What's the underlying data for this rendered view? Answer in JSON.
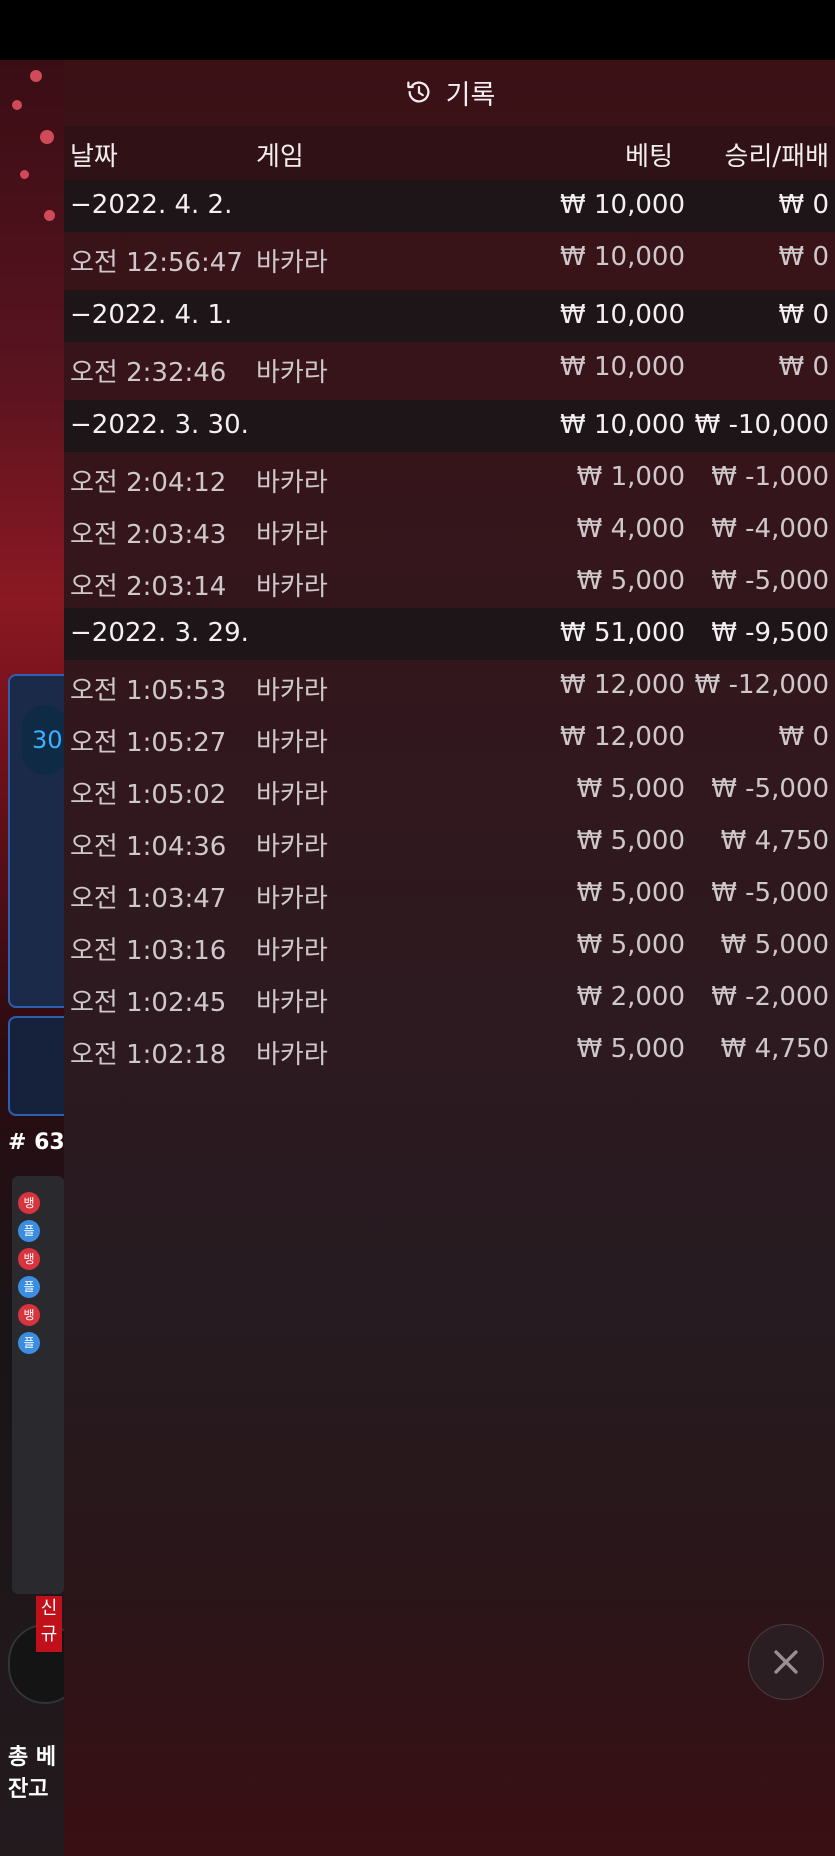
{
  "title": "기록",
  "headers": {
    "date": "날짜",
    "game": "게임",
    "bet": "베팅",
    "result": "승리/패배"
  },
  "groups": [
    {
      "date": "−2022. 4. 2.",
      "bet": "₩ 10,000",
      "result": "₩ 0",
      "rows": [
        {
          "time": "오전 12:56:47",
          "game": "바카라",
          "bet": "₩ 10,000",
          "result": "₩ 0"
        }
      ]
    },
    {
      "date": "−2022. 4. 1.",
      "bet": "₩ 10,000",
      "result": "₩ 0",
      "rows": [
        {
          "time": "오전 2:32:46",
          "game": "바카라",
          "bet": "₩ 10,000",
          "result": "₩ 0"
        }
      ]
    },
    {
      "date": "−2022. 3. 30.",
      "bet": "₩ 10,000",
      "result": "₩ -10,000",
      "rows": [
        {
          "time": "오전 2:04:12",
          "game": "바카라",
          "bet": "₩ 1,000",
          "result": "₩ -1,000"
        },
        {
          "time": "오전 2:03:43",
          "game": "바카라",
          "bet": "₩ 4,000",
          "result": "₩ -4,000"
        },
        {
          "time": "오전 2:03:14",
          "game": "바카라",
          "bet": "₩ 5,000",
          "result": "₩ -5,000"
        }
      ]
    },
    {
      "date": "−2022. 3. 29.",
      "bet": "₩ 51,000",
      "result": "₩ -9,500",
      "rows": [
        {
          "time": "오전 1:05:53",
          "game": "바카라",
          "bet": "₩ 12,000",
          "result": "₩ -12,000"
        },
        {
          "time": "오전 1:05:27",
          "game": "바카라",
          "bet": "₩ 12,000",
          "result": "₩ 0"
        },
        {
          "time": "오전 1:05:02",
          "game": "바카라",
          "bet": "₩ 5,000",
          "result": "₩ -5,000"
        },
        {
          "time": "오전 1:04:36",
          "game": "바카라",
          "bet": "₩ 5,000",
          "result": "₩ 4,750"
        },
        {
          "time": "오전 1:03:47",
          "game": "바카라",
          "bet": "₩ 5,000",
          "result": "₩ -5,000"
        },
        {
          "time": "오전 1:03:16",
          "game": "바카라",
          "bet": "₩ 5,000",
          "result": "₩ 5,000"
        },
        {
          "time": "오전 1:02:45",
          "game": "바카라",
          "bet": "₩ 2,000",
          "result": "₩ -2,000"
        },
        {
          "time": "오전 1:02:18",
          "game": "바카라",
          "bet": "₩ 5,000",
          "result": "₩ 4,750"
        }
      ]
    }
  ],
  "background": {
    "timer": "30",
    "round": "# 63",
    "badge": "신\n규",
    "road": [
      "뱅",
      "플",
      "뱅",
      "플",
      "뱅",
      "플"
    ],
    "total_label": "총 베",
    "balance_label": "잔고"
  },
  "icons": {
    "title_icon": "history-icon",
    "close": "close-icon"
  },
  "colors": {
    "banker": "#d7343d",
    "player": "#3a8de0"
  }
}
